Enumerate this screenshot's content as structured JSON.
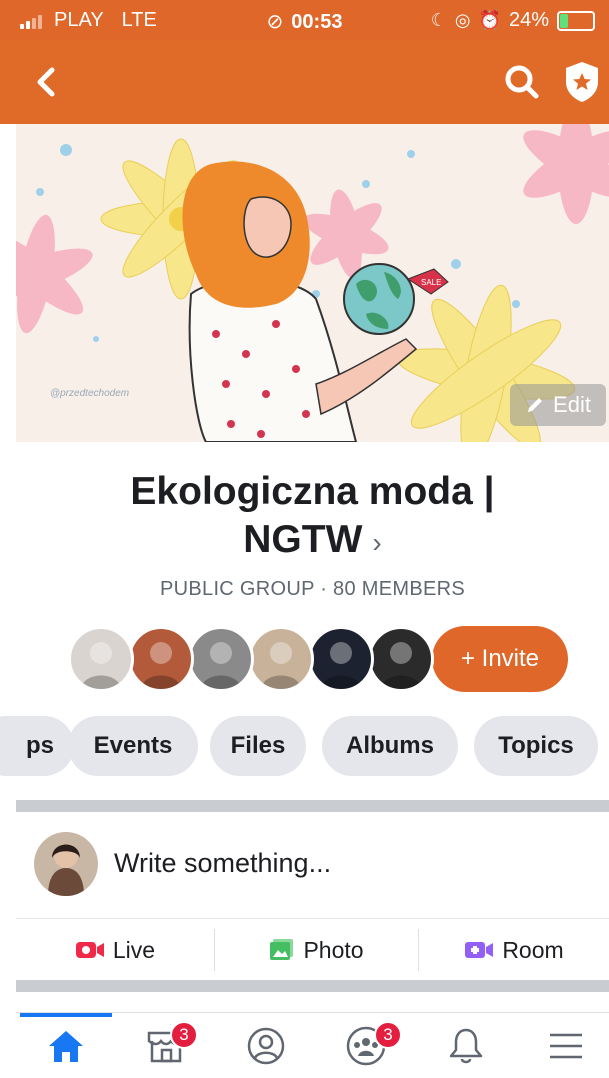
{
  "status_bar": {
    "carrier": "PLAY",
    "network": "LTE",
    "time": "00:53",
    "battery_percent": "24%",
    "battery_level": 0.24
  },
  "nav": {
    "back_icon": "chevron-left-icon",
    "search_icon": "search-icon",
    "admin_icon": "shield-star-icon"
  },
  "cover": {
    "watermark": "@przedtechodem",
    "edit_label": "Edit",
    "sale_tag": "SALE"
  },
  "group": {
    "name_line1": "Ekologiczna moda |",
    "name_line2": "NGTW",
    "chevron": "›",
    "meta": "PUBLIC GROUP · 80 MEMBERS"
  },
  "members": {
    "avatar_colors": [
      "#d9d4cf",
      "#b35a3a",
      "#8a8a8a",
      "#c8b39a",
      "#1d2230",
      "#2b2b2b"
    ],
    "invite_label": "+ Invite"
  },
  "tabs": [
    {
      "label": "ps"
    },
    {
      "label": "Events"
    },
    {
      "label": "Files"
    },
    {
      "label": "Albums"
    },
    {
      "label": "Topics"
    }
  ],
  "composer": {
    "placeholder": "Write something..."
  },
  "actions": [
    {
      "label": "Live",
      "icon": "live-video-icon",
      "color": "#f02849"
    },
    {
      "label": "Photo",
      "icon": "photo-icon",
      "color": "#45bd62"
    },
    {
      "label": "Room",
      "icon": "room-video-icon",
      "color": "#9360f7"
    }
  ],
  "bottom_nav": {
    "home_icon": "home-icon",
    "marketplace_badge": "3",
    "groups_badge": "3",
    "accent": "#1877f2"
  }
}
